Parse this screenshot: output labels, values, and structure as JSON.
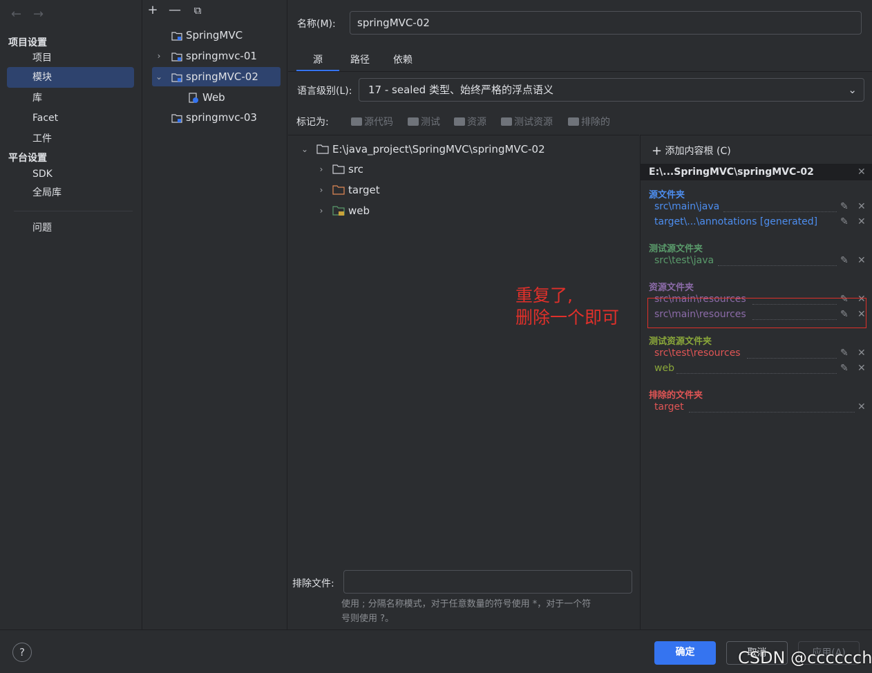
{
  "nav": {
    "back": "←",
    "forward": "→",
    "group_project": "项目设置",
    "items_project": [
      "项目",
      "模块",
      "库",
      "Facet",
      "工件"
    ],
    "group_platform": "平台设置",
    "items_platform": [
      "SDK",
      "全局库"
    ],
    "item_problems": "问题"
  },
  "modtree": {
    "toolbar": {
      "add": "+",
      "remove": "—",
      "copy": "⧉"
    },
    "modules": [
      {
        "name": "SpringMVC"
      },
      {
        "name": "springmvc-01"
      },
      {
        "name": "springMVC-02"
      },
      {
        "name": "Web"
      },
      {
        "name": "springmvc-03"
      }
    ]
  },
  "main": {
    "name_label": "名称(M):",
    "name_value": "springMVC-02",
    "tabs": [
      "源",
      "路径",
      "依赖"
    ],
    "lang_label": "语言级别(L):",
    "lang_value": "17 - sealed 类型、始终严格的浮点语义",
    "mark_label": "标记为:",
    "mark_buttons": [
      "源代码",
      "测试",
      "资源",
      "测试资源",
      "排除的"
    ],
    "tree": {
      "root": "E:\\java_project\\SpringMVC\\springMVC-02",
      "children": [
        "src",
        "target",
        "web"
      ]
    },
    "annotation_line1": "重复了,",
    "annotation_line2": "删除一个即可",
    "exclude_label": "排除文件:",
    "exclude_value": "",
    "exclude_hint_line1": "使用 ; 分隔名称模式，对于任意数量的符号使用 *，对于一个符",
    "exclude_hint_line2": "号则使用 ?。"
  },
  "roots": {
    "add_root": "添加内容根 (C)",
    "root_path": "E:\\...SpringMVC\\springMVC-02",
    "sections": {
      "source_title": "源文件夹",
      "source_paths": [
        "src\\main\\java",
        "target\\...\\annotations [generated]"
      ],
      "test_title": "测试源文件夹",
      "test_paths": [
        "src\\test\\java"
      ],
      "resource_title": "资源文件夹",
      "resource_paths": [
        "src\\main\\resources",
        "src\\main\\resources"
      ],
      "test_resource_title": "测试资源文件夹",
      "test_resource_paths": [
        "src\\test\\resources",
        "web"
      ],
      "excluded_title": "排除的文件夹",
      "excluded_paths": [
        "target"
      ]
    }
  },
  "footer": {
    "help": "?",
    "ok": "确定",
    "cancel": "取消",
    "apply": "应用(A)",
    "watermark": "CSDN @cccccchd"
  },
  "colors": {
    "accent": "#3574f0",
    "selection": "#2e436e",
    "source": "#4d8ef0",
    "test": "#5a9b6b",
    "resource": "#8c6ba9",
    "test_resource": "#8aa73a",
    "excluded": "#e05555",
    "annotation": "#e0302a"
  }
}
